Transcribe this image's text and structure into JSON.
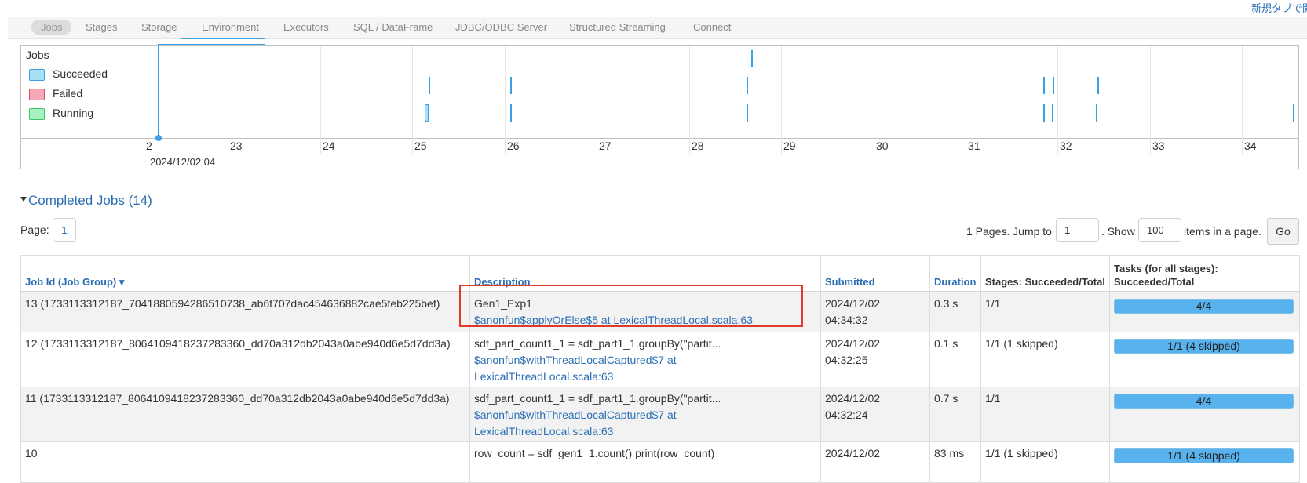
{
  "top_link": "新規タブで開く",
  "nav": {
    "tabs": [
      {
        "label": "Jobs",
        "active": true
      },
      {
        "label": "Stages"
      },
      {
        "label": "Storage"
      },
      {
        "label": "Environment"
      },
      {
        "label": "Executors"
      },
      {
        "label": "SQL / DataFrame"
      },
      {
        "label": "JDBC/ODBC Server"
      },
      {
        "label": "Structured Streaming"
      },
      {
        "label": "Connect"
      }
    ]
  },
  "timeline": {
    "jobs_label": "Jobs",
    "legend": [
      {
        "label": "Succeeded",
        "color": "#a6e0f7",
        "border": "#3aa0e8"
      },
      {
        "label": "Failed",
        "color": "#f7a6b4",
        "border": "#e0506a"
      },
      {
        "label": "Running",
        "color": "#a6f2c0",
        "border": "#3fc46a"
      }
    ],
    "ticks": [
      "2",
      "23",
      "24",
      "25",
      "26",
      "27",
      "28",
      "29",
      "30",
      "31",
      "32",
      "33",
      "34"
    ],
    "date_label": "2024/12/02 04"
  },
  "completed": {
    "header": "Completed Jobs (14)"
  },
  "pagination": {
    "page_label": "Page:",
    "current_page": "1",
    "pages_text": "1 Pages. Jump to",
    "jump_value": "1",
    "show_text": ". Show",
    "show_value": "100",
    "items_text": "items in a page.",
    "go_label": "Go"
  },
  "table": {
    "headers": {
      "job_id": "Job Id (Job Group) ▾",
      "description": "Description",
      "submitted": "Submitted",
      "duration": "Duration",
      "stages": "Stages: Succeeded/Total",
      "tasks": "Tasks (for all stages): Succeeded/Total"
    },
    "rows": [
      {
        "job_id": "13 (1733113312187_7041880594286510738_ab6f707dac454636882cae5feb225bef)",
        "desc_text": "Gen1_Exp1",
        "desc_link": "$anonfun$applyOrElse$5 at LexicalThreadLocal.scala:63",
        "submitted": "2024/12/02 04:34:32",
        "duration": "0.3 s",
        "stages": "1/1",
        "tasks": "4/4"
      },
      {
        "job_id": "12 (1733113312187_8064109418237283360_dd70a312db2043a0abe940d6e5d7dd3a)",
        "desc_text": "sdf_part_count1_1 = sdf_part1_1.groupBy(\"partit...",
        "desc_link": "$anonfun$withThreadLocalCaptured$7 at LexicalThreadLocal.scala:63",
        "submitted": "2024/12/02 04:32:25",
        "duration": "0.1 s",
        "stages": "1/1 (1 skipped)",
        "tasks": "1/1 (4 skipped)"
      },
      {
        "job_id": "11 (1733113312187_8064109418237283360_dd70a312db2043a0abe940d6e5d7dd3a)",
        "desc_text": "sdf_part_count1_1 = sdf_part1_1.groupBy(\"partit...",
        "desc_link": "$anonfun$withThreadLocalCaptured$7 at LexicalThreadLocal.scala:63",
        "submitted": "2024/12/02 04:32:24",
        "duration": "0.7 s",
        "stages": "1/1",
        "tasks": "4/4"
      },
      {
        "job_id": "10",
        "desc_text": "row_count = sdf_gen1_1.count() print(row_count)",
        "desc_link": "",
        "submitted": "2024/12/02",
        "duration": "83 ms",
        "stages": "1/1 (1 skipped)",
        "tasks": "1/1 (4 skipped)"
      }
    ]
  }
}
